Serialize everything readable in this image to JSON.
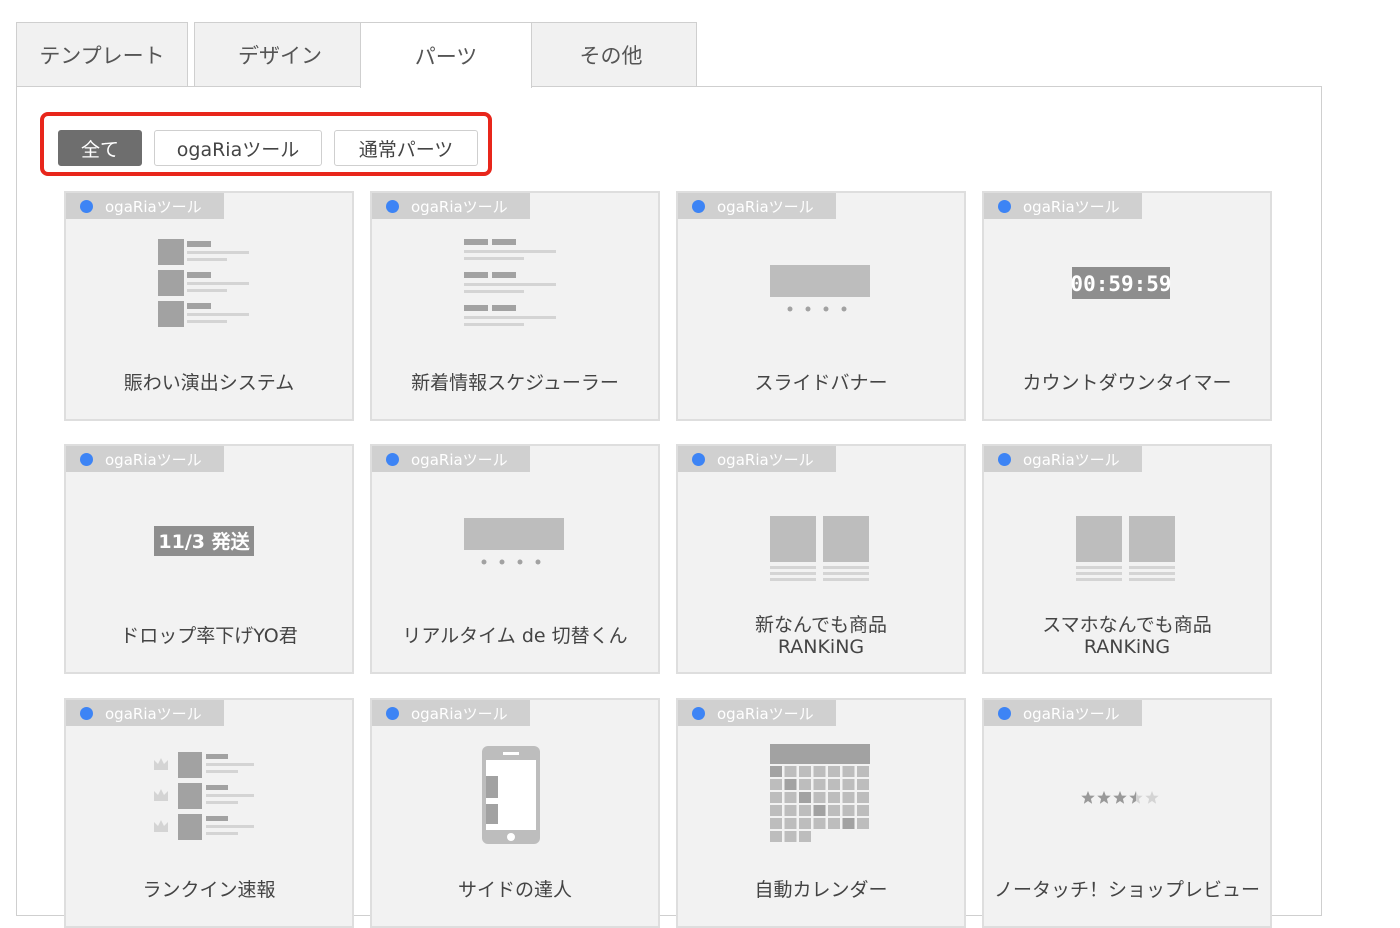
{
  "tabs": [
    "テンプレート",
    "デザイン",
    "パーツ",
    "その他"
  ],
  "active_tab": 2,
  "filters": [
    "全て",
    "ogaRiaツール",
    "通常パーツ"
  ],
  "active_filter": 0,
  "colors": {
    "accent_blue": "#3d84f5",
    "highlight_red": "#e8261b"
  },
  "cards": [
    {
      "badge": "ogaRiaツール",
      "name": "賑わい演出システム",
      "icon": "list-with-thumbnails-icon"
    },
    {
      "badge": "ogaRiaツール",
      "name": "新着情報スケジューラー",
      "icon": "news-list-icon"
    },
    {
      "badge": "ogaRiaツール",
      "name": "スライドバナー",
      "icon": "slide-banner-icon"
    },
    {
      "badge": "ogaRiaツール",
      "name": "カウントダウンタイマー",
      "icon": "countdown-timer-icon",
      "icon_text": "00:59:59"
    },
    {
      "badge": "ogaRiaツール",
      "name": "ドロップ率下げYO君",
      "icon": "shipping-date-icon",
      "icon_text": "11/3 発送"
    },
    {
      "badge": "ogaRiaツール",
      "name": "リアルタイム de 切替くん",
      "icon": "slide-banner-icon"
    },
    {
      "badge": "ogaRiaツール",
      "name": "新なんでも商品\nRANKiNG",
      "icon": "product-ranking-icon"
    },
    {
      "badge": "ogaRiaツール",
      "name": "スマホなんでも商品\nRANKiNG",
      "icon": "product-ranking-icon"
    },
    {
      "badge": "ogaRiaツール",
      "name": "ランクイン速報",
      "icon": "ranking-crown-icon"
    },
    {
      "badge": "ogaRiaツール",
      "name": "サイドの達人",
      "icon": "smartphone-side-icon"
    },
    {
      "badge": "ogaRiaツール",
      "name": "自動カレンダー",
      "icon": "calendar-icon"
    },
    {
      "badge": "ogaRiaツール",
      "name": "ノータッチ！ショップレビュー",
      "icon": "star-rating-icon",
      "rating": 3.5,
      "rating_max": 5
    }
  ]
}
